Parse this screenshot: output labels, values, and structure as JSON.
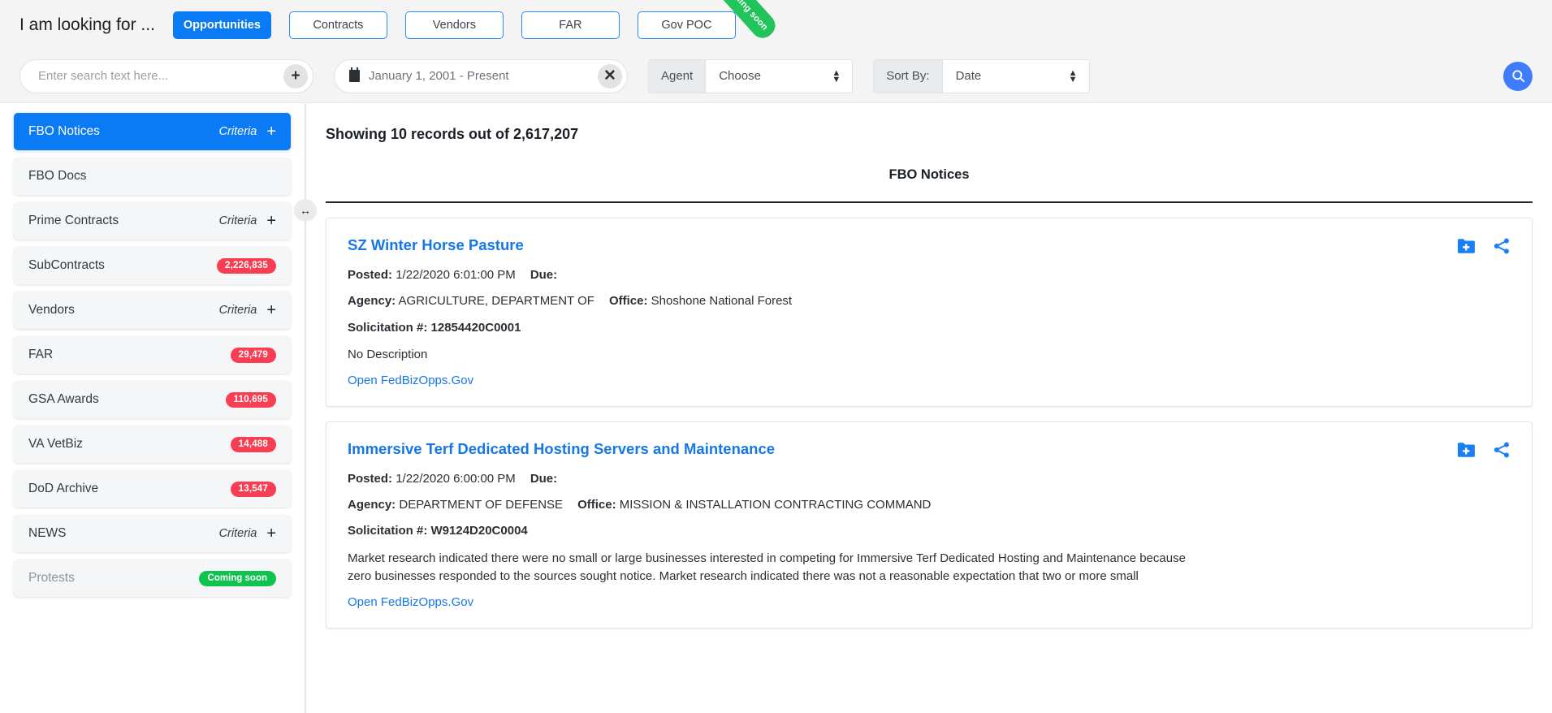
{
  "header": {
    "prompt": "I am looking for ...",
    "tabs": [
      {
        "label": "Opportunities",
        "active": true
      },
      {
        "label": "Contracts",
        "active": false
      },
      {
        "label": "Vendors",
        "active": false
      },
      {
        "label": "FAR",
        "active": false
      },
      {
        "label": "Gov POC",
        "active": false
      }
    ],
    "ribbon": "Coming soon"
  },
  "search": {
    "placeholder": "Enter search text here...",
    "value": "",
    "add_label": "+",
    "date_range": "January 1, 2001 - Present",
    "clear_label": "✕",
    "agent_label": "Agent",
    "agent_value": "Choose",
    "sort_label": "Sort By:",
    "sort_value": "Date",
    "go_icon": "search-icon"
  },
  "sidebar": {
    "items": [
      {
        "label": "FBO Notices",
        "criteria": "Criteria",
        "plus": "+",
        "badge": "",
        "badge_type": "",
        "active": true,
        "muted": false
      },
      {
        "label": "FBO Docs",
        "criteria": "",
        "plus": "",
        "badge": "",
        "badge_type": "",
        "active": false,
        "muted": false
      },
      {
        "label": "Prime Contracts",
        "criteria": "Criteria",
        "plus": "+",
        "badge": "",
        "badge_type": "",
        "active": false,
        "muted": false
      },
      {
        "label": "SubContracts",
        "criteria": "",
        "plus": "",
        "badge": "2,226,835",
        "badge_type": "red",
        "active": false,
        "muted": false
      },
      {
        "label": "Vendors",
        "criteria": "Criteria",
        "plus": "+",
        "badge": "",
        "badge_type": "",
        "active": false,
        "muted": false
      },
      {
        "label": "FAR",
        "criteria": "",
        "plus": "",
        "badge": "29,479",
        "badge_type": "red",
        "active": false,
        "muted": false
      },
      {
        "label": "GSA Awards",
        "criteria": "",
        "plus": "",
        "badge": "110,695",
        "badge_type": "red",
        "active": false,
        "muted": false
      },
      {
        "label": "VA VetBiz",
        "criteria": "",
        "plus": "",
        "badge": "14,488",
        "badge_type": "red",
        "active": false,
        "muted": false
      },
      {
        "label": "DoD Archive",
        "criteria": "",
        "plus": "",
        "badge": "13,547",
        "badge_type": "red",
        "active": false,
        "muted": false
      },
      {
        "label": "NEWS",
        "criteria": "Criteria",
        "plus": "+",
        "badge": "",
        "badge_type": "",
        "active": false,
        "muted": false
      },
      {
        "label": "Protests",
        "criteria": "",
        "plus": "",
        "badge": "Coming soon",
        "badge_type": "green",
        "active": false,
        "muted": true
      }
    ]
  },
  "main": {
    "records_text": "Showing 10 records out of 2,617,207",
    "section_title": "FBO Notices",
    "labels": {
      "posted": "Posted:",
      "due": "Due:",
      "agency": "Agency:",
      "office": "Office:",
      "solicitation": "Solicitation #:"
    },
    "cards": [
      {
        "title": "SZ Winter Horse Pasture",
        "posted": "1/22/2020 6:01:00 PM",
        "due": "",
        "agency": "AGRICULTURE, DEPARTMENT OF",
        "office": "Shoshone National Forest",
        "solicitation": "12854420C0001",
        "description": "No Description",
        "link": "Open FedBizOpps.Gov"
      },
      {
        "title": "Immersive Terf Dedicated Hosting Servers and Maintenance",
        "posted": "1/22/2020 6:00:00 PM",
        "due": "",
        "agency": "DEPARTMENT OF DEFENSE",
        "office": "MISSION & INSTALLATION CONTRACTING COMMAND",
        "solicitation": "W9124D20C0004",
        "description": "Market research indicated there were no small or large businesses interested in competing for Immersive Terf Dedicated Hosting and Maintenance because zero businesses responded to the sources sought notice.  Market research indicated there was not a reasonable expectation that two or more small",
        "link": "Open FedBizOpps.Gov"
      }
    ]
  },
  "colors": {
    "accent_blue": "#0b7bf5",
    "link_blue": "#1677e8",
    "badge_red": "#f73e52",
    "badge_green": "#0ec44f"
  }
}
